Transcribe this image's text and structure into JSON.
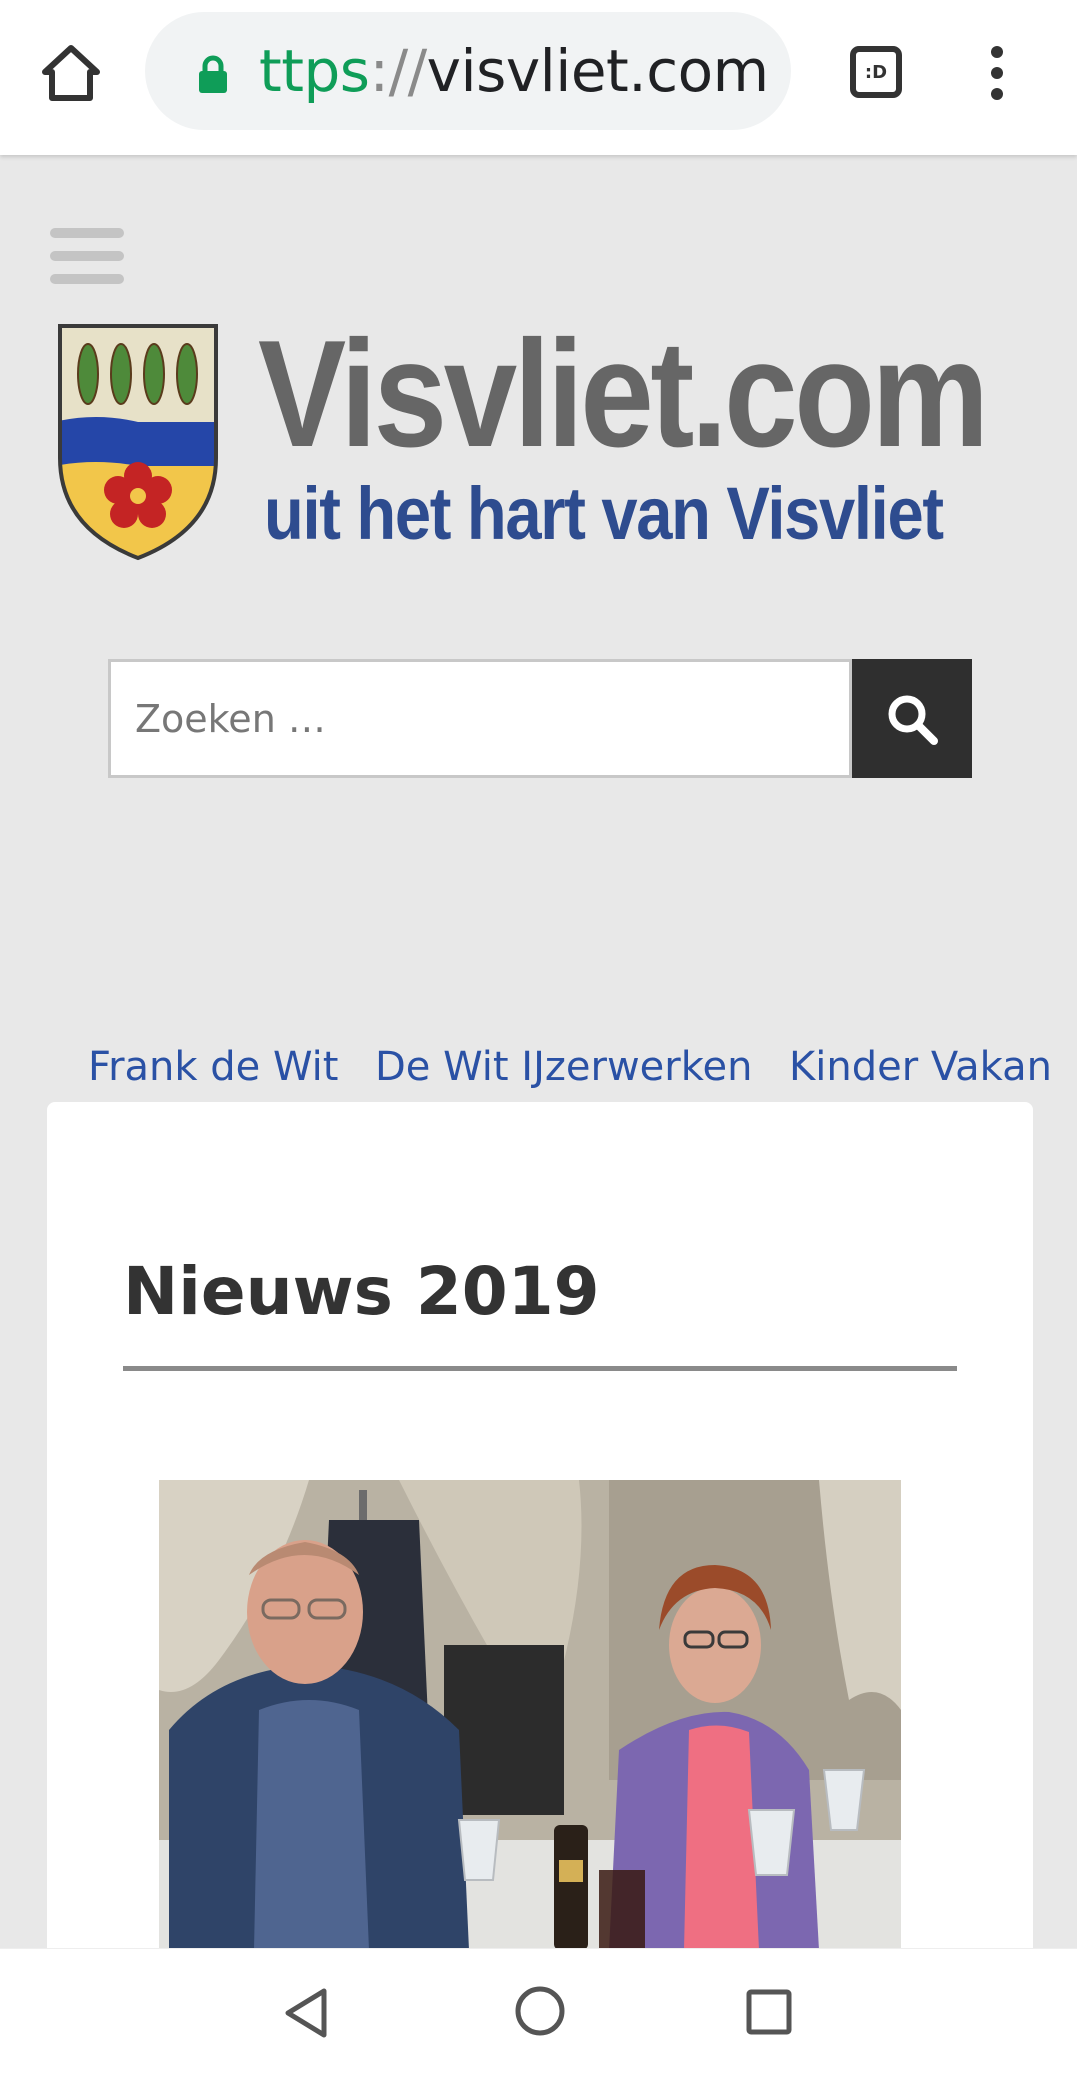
{
  "browser": {
    "url_scheme": "ttps",
    "url_separator": "://",
    "url_host": "visvliet.com",
    "tab_badge": ":D",
    "accent_green": "#0f9d58"
  },
  "site": {
    "logo_title": "Visvliet.com",
    "logo_tagline": "uit het hart van Visvliet",
    "brand_blue": "#2e4c8f",
    "search_placeholder": "Zoeken …"
  },
  "nav": {
    "links": [
      {
        "label": "Frank de Wit"
      },
      {
        "label": "De Wit IJzerwerken"
      },
      {
        "label": "Kinder Vakan"
      }
    ]
  },
  "post": {
    "title": "Nieuws 2019"
  },
  "icons": {
    "home": "home-icon",
    "lock": "lock-icon",
    "tabs": "tab-switcher-icon",
    "menu": "more-vert-icon",
    "hamburger": "hamburger-icon",
    "search": "search-icon",
    "back": "android-back-icon",
    "android_home": "android-home-icon",
    "recents": "android-recents-icon"
  }
}
